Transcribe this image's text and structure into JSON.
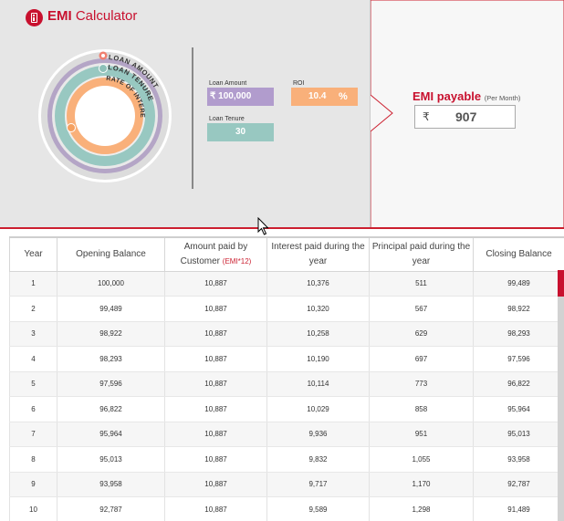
{
  "app": {
    "title_bold": "EMI",
    "title_rest": " Calculator"
  },
  "dial": {
    "labels": [
      "LOAN AMOUNT",
      "LOAN TENURE",
      "RATE OF INTEREST"
    ],
    "colors": {
      "loan_amount": "#b19ccd",
      "loan_tenure": "#98c8c1",
      "rate_of_interest": "#f9b07a"
    }
  },
  "inputs": {
    "loan_amount": {
      "label": "Loan Amount",
      "value": "₹ 100,000"
    },
    "roi": {
      "label": "ROI",
      "value": "10.4",
      "unit": "%"
    },
    "loan_tenure": {
      "label": "Loan Tenure",
      "value": "30"
    }
  },
  "result": {
    "title": "EMI payable",
    "subtitle": "(Per Month)",
    "currency": "₹",
    "value": "907"
  },
  "table": {
    "headers": {
      "year": "Year",
      "opening": "Opening Balance",
      "amount_paid": "Amount paid by Customer",
      "amount_paid_note": "(EMI*12)",
      "interest": "Interest paid during the year",
      "principal": "Principal paid during the year",
      "closing": "Closing Balance"
    },
    "rows": [
      [
        "1",
        "100,000",
        "10,887",
        "10,376",
        "511",
        "99,489"
      ],
      [
        "2",
        "99,489",
        "10,887",
        "10,320",
        "567",
        "98,922"
      ],
      [
        "3",
        "98,922",
        "10,887",
        "10,258",
        "629",
        "98,293"
      ],
      [
        "4",
        "98,293",
        "10,887",
        "10,190",
        "697",
        "97,596"
      ],
      [
        "5",
        "97,596",
        "10,887",
        "10,114",
        "773",
        "96,822"
      ],
      [
        "6",
        "96,822",
        "10,887",
        "10,029",
        "858",
        "95,964"
      ],
      [
        "7",
        "95,964",
        "10,887",
        "9,936",
        "951",
        "95,013"
      ],
      [
        "8",
        "95,013",
        "10,887",
        "9,832",
        "1,055",
        "93,958"
      ],
      [
        "9",
        "93,958",
        "10,887",
        "9,717",
        "1,170",
        "92,787"
      ],
      [
        "10",
        "92,787",
        "10,887",
        "9,589",
        "1,298",
        "91,489"
      ]
    ]
  },
  "colors": {
    "brand": "#c8102e"
  }
}
